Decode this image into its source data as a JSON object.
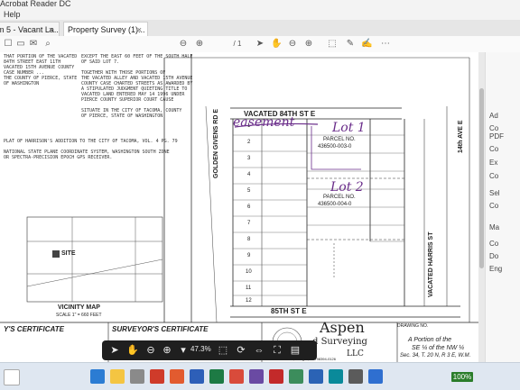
{
  "app": {
    "window_title": "Acrobat Reader DC",
    "menu": [
      "Help"
    ]
  },
  "tabs": [
    {
      "label": "m 5 - Vacant La...",
      "close": "×"
    },
    {
      "label": "Property Survey (1)...",
      "close": "×"
    }
  ],
  "toolbar": {
    "page_current": "1",
    "page_total": "/ 1"
  },
  "float_toolbar": {
    "zoom": "47.3%"
  },
  "right_panel": {
    "label_lines": [
      "Ad",
      "Co",
      "PDF",
      "Co",
      "Ex",
      "Co",
      "Sel",
      "Co",
      "Ma",
      "Co",
      "Do",
      "Eng"
    ]
  },
  "document": {
    "street_top": "VACATED 84TH ST E",
    "street_bottom": "85TH ST E",
    "street_left": "GOLDEN GIVENS RD E",
    "street_right_1": "VACATED HARRIS ST",
    "street_right_2": "14th AVE E",
    "parcel_1": "PARCEL NO.",
    "parcel_1_num": "436500-003-0",
    "parcel_2": "PARCEL NO.",
    "parcel_2_num": "436500-004-0",
    "vicinity_title": "VICINITY MAP",
    "vicinity_scale": "SCALE 1\" = 660 FEET",
    "vicinity_site": "SITE",
    "surveyor_cert": "SURVEYOR'S CERTIFICATE",
    "county_cert": "Y'S CERTIFICATE",
    "company_1": "Aspen",
    "company_2": "d Surveying",
    "company_3": "LLC",
    "portion_1": "A Portion of the",
    "portion_2": "SE ¼ of the NW ¼",
    "portion_3": "Sec. 34, T. 20 N, R 3 E, W.M.",
    "company_addr": "P.O. Box 124, Tenighs, WA  98394-0126",
    "drawing_label": "DRAWING NO.",
    "lot_labels": [
      "1",
      "2",
      "3",
      "4",
      "5",
      "6",
      "7",
      "8",
      "9",
      "10",
      "11",
      "12"
    ]
  },
  "handwritten": {
    "easement": "easement",
    "lot_1": "Lot 1",
    "lot_2": "Lot 2"
  },
  "taskbar": {
    "battery": "100%"
  },
  "colors": {
    "accent": "#2a7d2a",
    "ink": "#6a2d8a"
  }
}
